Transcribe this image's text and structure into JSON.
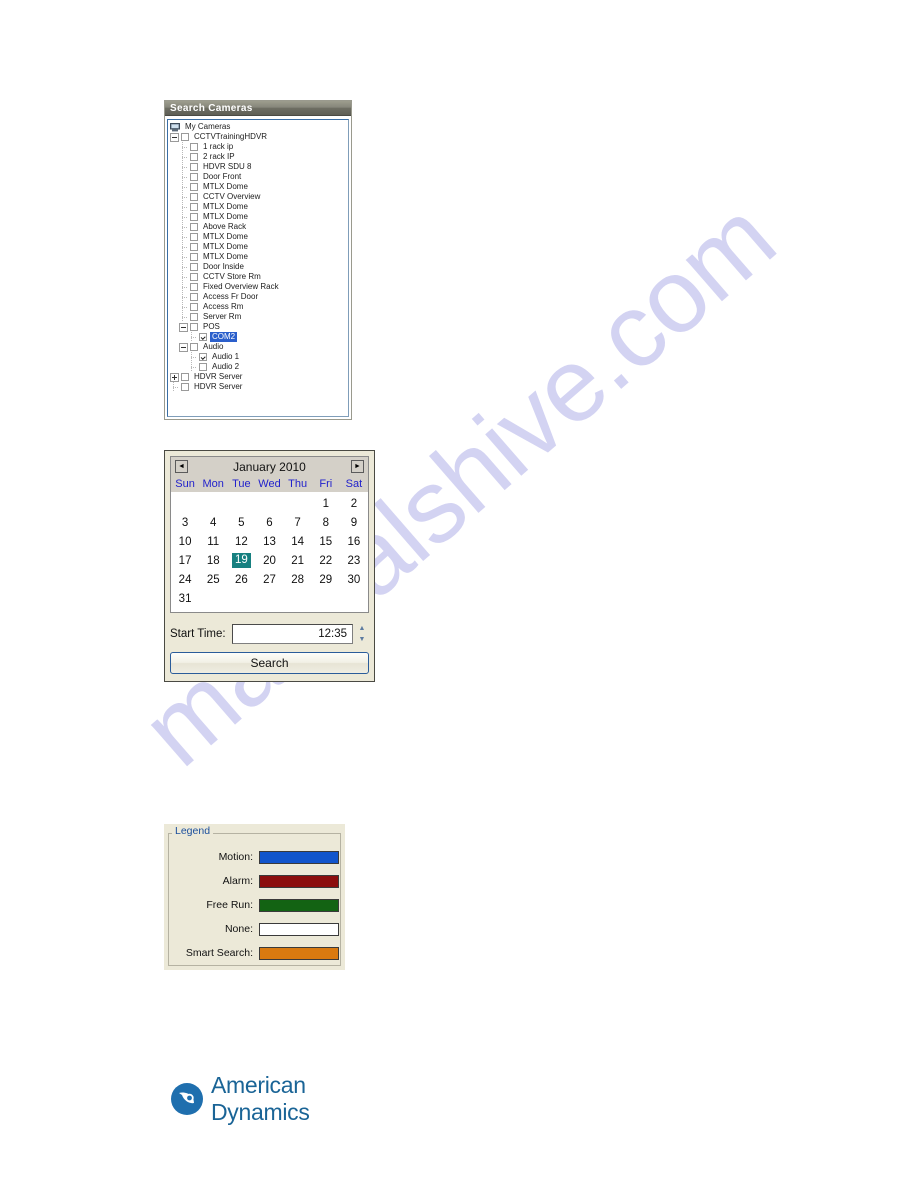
{
  "watermark": {
    "text": "manualshive.com"
  },
  "camera_panel": {
    "title": "Search Cameras",
    "tree": [
      {
        "label": "My Cameras",
        "depth": 0,
        "expander": "none",
        "checkbox": "none",
        "icon": "computer-icon",
        "selected": false
      },
      {
        "label": "CCTVTrainingHDVR",
        "depth": 1,
        "expander": "minus",
        "checkbox": "unchecked",
        "selected": false
      },
      {
        "label": "1 rack ip",
        "depth": 2,
        "expander": "none",
        "checkbox": "unchecked",
        "selected": false
      },
      {
        "label": "2 rack IP",
        "depth": 2,
        "expander": "none",
        "checkbox": "unchecked",
        "selected": false
      },
      {
        "label": "HDVR SDU 8",
        "depth": 2,
        "expander": "none",
        "checkbox": "unchecked",
        "selected": false
      },
      {
        "label": "Door Front",
        "depth": 2,
        "expander": "none",
        "checkbox": "unchecked",
        "selected": false
      },
      {
        "label": "MTLX Dome",
        "depth": 2,
        "expander": "none",
        "checkbox": "unchecked",
        "selected": false
      },
      {
        "label": "CCTV Overview",
        "depth": 2,
        "expander": "none",
        "checkbox": "unchecked",
        "selected": false
      },
      {
        "label": "MTLX Dome",
        "depth": 2,
        "expander": "none",
        "checkbox": "unchecked",
        "selected": false
      },
      {
        "label": "MTLX Dome",
        "depth": 2,
        "expander": "none",
        "checkbox": "unchecked",
        "selected": false
      },
      {
        "label": "Above Rack",
        "depth": 2,
        "expander": "none",
        "checkbox": "unchecked",
        "selected": false
      },
      {
        "label": "MTLX Dome",
        "depth": 2,
        "expander": "none",
        "checkbox": "unchecked",
        "selected": false
      },
      {
        "label": "MTLX Dome",
        "depth": 2,
        "expander": "none",
        "checkbox": "unchecked",
        "selected": false
      },
      {
        "label": "MTLX Dome",
        "depth": 2,
        "expander": "none",
        "checkbox": "unchecked",
        "selected": false
      },
      {
        "label": "Door Inside",
        "depth": 2,
        "expander": "none",
        "checkbox": "unchecked",
        "selected": false
      },
      {
        "label": "CCTV Store Rm",
        "depth": 2,
        "expander": "none",
        "checkbox": "unchecked",
        "selected": false
      },
      {
        "label": "Fixed Overview Rack",
        "depth": 2,
        "expander": "none",
        "checkbox": "unchecked",
        "selected": false
      },
      {
        "label": "Access Fr Door",
        "depth": 2,
        "expander": "none",
        "checkbox": "unchecked",
        "selected": false
      },
      {
        "label": "Access Rm",
        "depth": 2,
        "expander": "none",
        "checkbox": "unchecked",
        "selected": false
      },
      {
        "label": "Server Rm",
        "depth": 2,
        "expander": "none",
        "checkbox": "unchecked",
        "selected": false
      },
      {
        "label": "POS",
        "depth": 2,
        "expander": "minus",
        "checkbox": "unchecked",
        "selected": false
      },
      {
        "label": "COM2",
        "depth": 3,
        "expander": "none",
        "checkbox": "checked",
        "selected": true
      },
      {
        "label": "Audio",
        "depth": 2,
        "expander": "minus",
        "checkbox": "unchecked",
        "selected": false
      },
      {
        "label": "Audio 1",
        "depth": 3,
        "expander": "none",
        "checkbox": "checked",
        "selected": false
      },
      {
        "label": "Audio 2",
        "depth": 3,
        "expander": "none",
        "checkbox": "unchecked",
        "selected": false
      },
      {
        "label": "HDVR Server",
        "depth": 1,
        "expander": "plus",
        "checkbox": "unchecked",
        "selected": false
      },
      {
        "label": "HDVR Server",
        "depth": 1,
        "expander": "none",
        "checkbox": "unchecked",
        "selected": false
      }
    ]
  },
  "calendar": {
    "prev_label": "◄",
    "next_label": "►",
    "month_title": "January 2010",
    "day_names": [
      "Sun",
      "Mon",
      "Tue",
      "Wed",
      "Thu",
      "Fri",
      "Sat"
    ],
    "leading_blanks": 5,
    "days": [
      1,
      2,
      3,
      4,
      5,
      6,
      7,
      8,
      9,
      10,
      11,
      12,
      13,
      14,
      15,
      16,
      17,
      18,
      19,
      20,
      21,
      22,
      23,
      24,
      25,
      26,
      27,
      28,
      29,
      30,
      31
    ],
    "selected_day": 19,
    "highlight_color": "#178080",
    "time_label": "Start Time:",
    "time_value": "12:35",
    "spinner_up": "▲",
    "spinner_down": "▼",
    "search_label": "Search"
  },
  "legend": {
    "title": "Legend",
    "rows": [
      {
        "label": "Motion:",
        "color": "#1155cc"
      },
      {
        "label": "Alarm:",
        "color": "#8b0d0d"
      },
      {
        "label": "Free Run:",
        "color": "#136313"
      },
      {
        "label": "None:",
        "color": "#ffffff"
      },
      {
        "label": "Smart Search:",
        "color": "#d97a10"
      }
    ]
  },
  "logo": {
    "text": "American Dynamics",
    "color": "#1a6496"
  }
}
